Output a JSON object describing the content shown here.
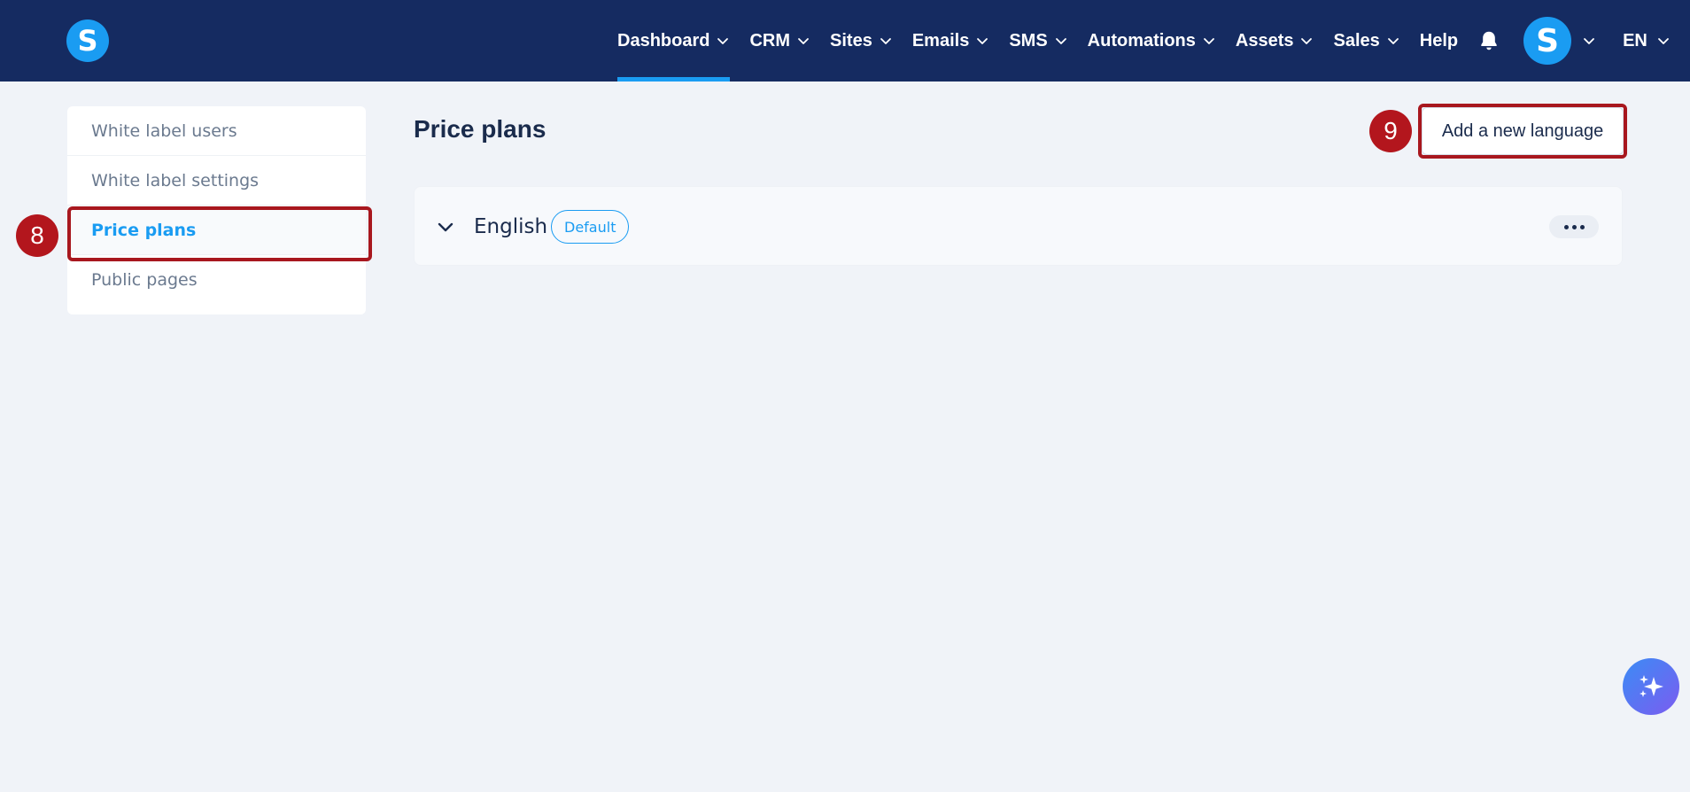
{
  "app": {
    "logo_letter": "S",
    "brand_color": "#1a9cf2",
    "nav_bg": "#152b61"
  },
  "nav": {
    "items": [
      {
        "label": "Dashboard",
        "active": true,
        "has_dropdown": true
      },
      {
        "label": "CRM",
        "has_dropdown": true
      },
      {
        "label": "Sites",
        "has_dropdown": true
      },
      {
        "label": "Emails",
        "has_dropdown": true
      },
      {
        "label": "SMS",
        "has_dropdown": true
      },
      {
        "label": "Automations",
        "has_dropdown": true
      },
      {
        "label": "Assets",
        "has_dropdown": true
      },
      {
        "label": "Sales",
        "has_dropdown": true
      },
      {
        "label": "Help",
        "has_dropdown": false
      }
    ],
    "notification_icon": "bell-icon",
    "avatar_letter": "S",
    "language": "EN"
  },
  "sidebar": {
    "items": [
      {
        "label": "White label users"
      },
      {
        "label": "White label settings"
      },
      {
        "label": "Price plans",
        "active": true
      },
      {
        "label": "Public pages"
      }
    ]
  },
  "main": {
    "title": "Price plans",
    "add_button_label": "Add a new language",
    "languages": [
      {
        "name": "English",
        "badge": "Default"
      }
    ]
  },
  "annotations": {
    "step_sidebar": "8",
    "step_add_button": "9",
    "highlight_color": "#a8171e"
  }
}
